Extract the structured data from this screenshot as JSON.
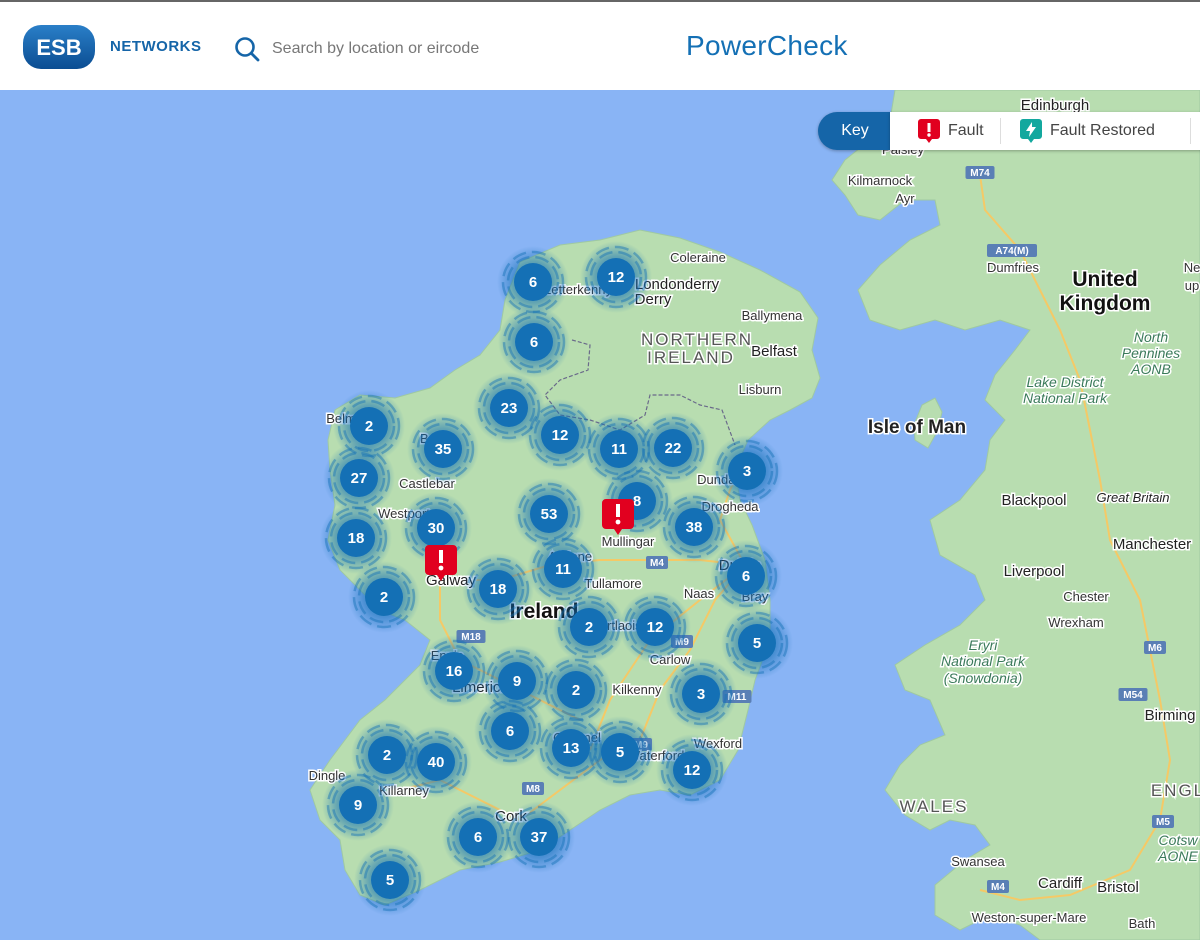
{
  "header": {
    "logo_text": "ESB",
    "brand": "NETWORKS",
    "search_placeholder": "Search by location or eircode",
    "app_title": "PowerCheck"
  },
  "key": {
    "button_label": "Key",
    "items": [
      {
        "label": "Fault",
        "icon": "fault-icon",
        "color": "#e1001f"
      },
      {
        "label": "Fault Restored",
        "icon": "fault-restored-icon",
        "color": "#13a89e"
      }
    ]
  },
  "colors": {
    "sea": "#89b4f5",
    "land": "#b8ddb0",
    "cluster": "#1470b5",
    "fault": "#e1001f",
    "brand": "#1565a8"
  },
  "map_labels": [
    {
      "text": "Edinburgh",
      "cls": "city"
    },
    {
      "text": "Paisley",
      "cls": "town"
    },
    {
      "text": "Kilmarnock",
      "cls": "town"
    },
    {
      "text": "Ayr",
      "cls": "town"
    },
    {
      "text": "M74",
      "cls": "road"
    },
    {
      "text": "A74(M)",
      "cls": "road"
    },
    {
      "text": "Dumfries",
      "cls": "town"
    },
    {
      "text": "United",
      "cls": "country"
    },
    {
      "text": "Kingdom",
      "cls": "country"
    },
    {
      "text": "Ne",
      "cls": "town"
    },
    {
      "text": "up",
      "cls": "town"
    },
    {
      "text": "Coleraine",
      "cls": "town"
    },
    {
      "text": "Londonderry",
      "cls": "city"
    },
    {
      "text": "Derry",
      "cls": "city"
    },
    {
      "text": "Letterkenny",
      "cls": "town"
    },
    {
      "text": "Ballymena",
      "cls": "town"
    },
    {
      "text": "NORTHERN",
      "cls": "region"
    },
    {
      "text": "IRELAND",
      "cls": "region"
    },
    {
      "text": "Belfast",
      "cls": "city"
    },
    {
      "text": "Lisburn",
      "cls": "town"
    },
    {
      "text": "North",
      "cls": "park"
    },
    {
      "text": "Pennines",
      "cls": "park"
    },
    {
      "text": "AONB",
      "cls": "park"
    },
    {
      "text": "Lake District",
      "cls": "park"
    },
    {
      "text": "National Park",
      "cls": "park"
    },
    {
      "text": "Isle of Man",
      "cls": "island"
    },
    {
      "text": "Belm",
      "cls": "town"
    },
    {
      "text": "Ba",
      "cls": "town"
    },
    {
      "text": "Castlebar",
      "cls": "town"
    },
    {
      "text": "Westport",
      "cls": "town"
    },
    {
      "text": "Dundalk",
      "cls": "town"
    },
    {
      "text": "Drogheda",
      "cls": "town"
    },
    {
      "text": "Mullingar",
      "cls": "town"
    },
    {
      "text": "Athlone",
      "cls": "town"
    },
    {
      "text": "Tullamore",
      "cls": "town"
    },
    {
      "text": "M4",
      "cls": "road"
    },
    {
      "text": "Dublin",
      "cls": "city"
    },
    {
      "text": "Bray",
      "cls": "town"
    },
    {
      "text": "Naas",
      "cls": "town"
    },
    {
      "text": "Galway",
      "cls": "city"
    },
    {
      "text": "Ireland",
      "cls": "country"
    },
    {
      "text": "Portlaoise",
      "cls": "town"
    },
    {
      "text": "M9",
      "cls": "road"
    },
    {
      "text": "M18",
      "cls": "road"
    },
    {
      "text": "Ennis",
      "cls": "town"
    },
    {
      "text": "Carlow",
      "cls": "town"
    },
    {
      "text": "Limerick",
      "cls": "city"
    },
    {
      "text": "Kilkenny",
      "cls": "town"
    },
    {
      "text": "M11",
      "cls": "road"
    },
    {
      "text": "Clonmel",
      "cls": "town"
    },
    {
      "text": "M9",
      "cls": "road"
    },
    {
      "text": "Waterford",
      "cls": "town"
    },
    {
      "text": "Wexford",
      "cls": "town"
    },
    {
      "text": "Dingle",
      "cls": "town"
    },
    {
      "text": "Killarney",
      "cls": "town"
    },
    {
      "text": "M8",
      "cls": "road"
    },
    {
      "text": "Cork",
      "cls": "city"
    },
    {
      "text": "Blackpool",
      "cls": "city"
    },
    {
      "text": "Great Britain",
      "cls": "italic"
    },
    {
      "text": "Manchester",
      "cls": "city"
    },
    {
      "text": "Liverpool",
      "cls": "city"
    },
    {
      "text": "Chester",
      "cls": "town"
    },
    {
      "text": "Wrexham",
      "cls": "town"
    },
    {
      "text": "Eryri",
      "cls": "park"
    },
    {
      "text": "National Park",
      "cls": "park"
    },
    {
      "text": "(Snowdonia)",
      "cls": "park"
    },
    {
      "text": "M6",
      "cls": "road"
    },
    {
      "text": "M54",
      "cls": "road"
    },
    {
      "text": "Birming",
      "cls": "city"
    },
    {
      "text": "WALES",
      "cls": "region"
    },
    {
      "text": "ENGL",
      "cls": "region"
    },
    {
      "text": "M5",
      "cls": "road"
    },
    {
      "text": "Cotsw",
      "cls": "park"
    },
    {
      "text": "AONE",
      "cls": "park"
    },
    {
      "text": "Swansea",
      "cls": "town"
    },
    {
      "text": "M4",
      "cls": "road"
    },
    {
      "text": "Cardiff",
      "cls": "city"
    },
    {
      "text": "Bristol",
      "cls": "city"
    },
    {
      "text": "Weston-super-Mare",
      "cls": "town"
    },
    {
      "text": "Bath",
      "cls": "town"
    }
  ],
  "clusters": [
    "6",
    "12",
    "6",
    "23",
    "2",
    "35",
    "12",
    "11",
    "22",
    "3",
    "27",
    "18",
    "30",
    "53",
    "8",
    "38",
    "2",
    "18",
    "11",
    "6",
    "2",
    "12",
    "5",
    "16",
    "9",
    "2",
    "3",
    "2",
    "40",
    "6",
    "13",
    "5",
    "12",
    "9",
    "6",
    "37",
    "5"
  ]
}
